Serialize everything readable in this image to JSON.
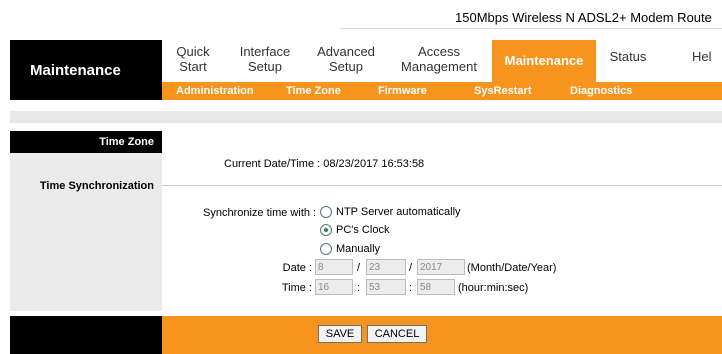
{
  "header": {
    "product_title": "150Mbps Wireless N ADSL2+ Modem Route",
    "brand_section": "Maintenance"
  },
  "topnav": {
    "tabs": [
      {
        "label_line1": "Quick",
        "label_line2": "Start"
      },
      {
        "label_line1": "Interface",
        "label_line2": "Setup"
      },
      {
        "label_line1": "Advanced",
        "label_line2": "Setup"
      },
      {
        "label_line1": "Access",
        "label_line2": "Management"
      },
      {
        "label": "Maintenance",
        "active": true
      },
      {
        "label": "Status"
      },
      {
        "label": "Hel"
      }
    ]
  },
  "subnav": {
    "items": [
      "Administration",
      "Time Zone",
      "Firmware",
      "SysRestart",
      "Diagnostics"
    ],
    "active": "Time Zone"
  },
  "sidebar": {
    "section_title": "Time Zone",
    "section_label": "Time Synchronization"
  },
  "content": {
    "current_datetime_label": "Current Date/Time :",
    "current_datetime_value": "08/23/2017 16:53:58",
    "sync_label": "Synchronize time with :",
    "options": [
      {
        "label": "NTP Server automatically",
        "checked": false
      },
      {
        "label": "PC's Clock",
        "checked": true
      },
      {
        "label": "Manually",
        "checked": false
      }
    ],
    "date": {
      "label": "Date :",
      "month": "8",
      "day": "23",
      "year": "2017",
      "separator": "/",
      "format_hint": "(Month/Date/Year)"
    },
    "time": {
      "label": "Time :",
      "hour": "16",
      "minute": "53",
      "second": "58",
      "separator": ":",
      "format_hint": "(hour:min:sec)"
    }
  },
  "footer": {
    "save_label": "SAVE",
    "cancel_label": "CANCEL"
  },
  "colors": {
    "accent_orange": "#f7941d",
    "sidebar_black": "#000000",
    "sidebar_gray": "#ebebeb",
    "radio_checked": "#1a8f2a"
  }
}
